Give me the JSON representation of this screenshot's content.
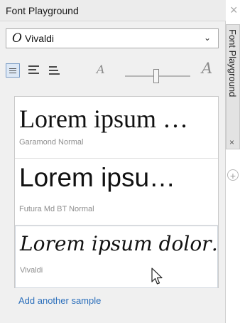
{
  "panel": {
    "title": "Font Playground",
    "close_glyph": "×"
  },
  "font_selector": {
    "icon": "o-font-icon",
    "icon_glyph": "O",
    "selected": "Vivaldi",
    "arrow_glyph": "⌄"
  },
  "toolbar": {
    "buttons": [
      {
        "name": "single-line-view",
        "active": true
      },
      {
        "name": "paragraph-view",
        "active": false
      },
      {
        "name": "waterfall-view",
        "active": false
      }
    ],
    "zoom_small_glyph": "A",
    "zoom_large_glyph": "A"
  },
  "samples": [
    {
      "text": "Lorem ipsum …",
      "label": "Garamond Normal"
    },
    {
      "text": "Lorem ipsu…",
      "label": "Futura Md BT Normal"
    },
    {
      "text": "Lorem ipsum dolor…",
      "label": "Vivaldi"
    }
  ],
  "add_sample_label": "Add another sample",
  "side_tab": {
    "label": "Font Playground",
    "close_glyph": "×",
    "add_glyph": "+"
  },
  "colors": {
    "panel_bg": "#f0f0f0",
    "link": "#2a6ebb",
    "sample_label": "#8e8e8e"
  }
}
